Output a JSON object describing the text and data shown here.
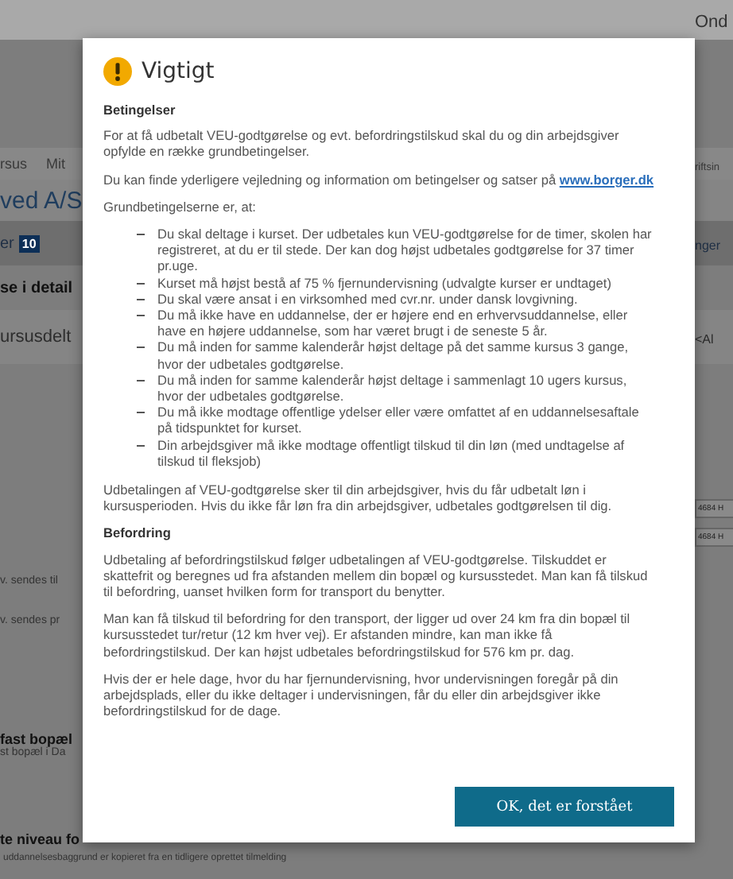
{
  "background": {
    "rows": [
      {
        "kind": "top",
        "right": "Ond"
      },
      {
        "kind": "nav",
        "left": [
          "rsus",
          "Mit"
        ],
        "right": "riftsin"
      },
      {
        "kind": "title",
        "left": [
          "ved A/S"
        ]
      },
      {
        "kind": "tabs",
        "left": [
          "er"
        ],
        "badge": "10",
        "right": "nger"
      },
      {
        "kind": "section",
        "left": [
          "se i detail"
        ]
      },
      {
        "kind": "subtitle",
        "left": [
          "ursusdelt"
        ],
        "right": "<Al"
      },
      {
        "kind": "input",
        "right": "4684 H"
      },
      {
        "kind": "input",
        "right": "4684 H"
      },
      {
        "kind": "field",
        "left": [
          "v. sendes til"
        ]
      },
      {
        "kind": "field",
        "left": [
          "v. sendes pr"
        ]
      },
      {
        "kind": "bold",
        "left": [
          "fast bopæl"
        ],
        "sub": "st bopæl i Da"
      },
      {
        "kind": "bold",
        "left": [
          "te niveau fo"
        ]
      }
    ],
    "footer_note": "uddannelsesbaggrund er kopieret fra en tidligere oprettet tilmelding"
  },
  "dialog": {
    "title": "Vigtigt",
    "sections": [
      {
        "kind": "heading",
        "text": "Betingelser"
      },
      {
        "kind": "paragraph",
        "text": "For at få udbetalt VEU-godtgørelse og evt. befordringstilskud skal du og din arbejdsgiver opfylde en række grundbetingelser."
      },
      {
        "kind": "link_paragraph",
        "text": "Du kan finde yderligere vejledning og information om betingelser og satser på",
        "link": "www.borger.dk"
      },
      {
        "kind": "paragraph",
        "text": "Grundbetingelserne er, at:"
      },
      {
        "kind": "list",
        "items": [
          "Du skal deltage i kurset. Der udbetales kun VEU-godtgørelse for de timer, skolen har registreret, at du er til stede. Der kan dog højst udbetales godtgørelse for 37 timer pr.uge.",
          "Kurset må højst bestå af 75 % fjernundervisning (udvalgte kurser er undtaget)",
          "Du skal være ansat i en virksomhed med cvr.nr. under dansk lovgivning.",
          "Du må ikke have en uddannelse, der er højere end en erhvervsuddannelse, eller have en højere uddannelse, som har været brugt i de seneste 5 år.",
          "Du må inden for samme kalenderår højst deltage på det samme kursus 3 gange, hvor der udbetales godtgørelse.",
          "Du må inden for samme kalenderår højst deltage i sammenlagt 10 ugers kursus, hvor der udbetales godtgørelse.",
          "Du må ikke modtage offentlige ydelser eller være omfattet af en uddannelsesaftale på tidspunktet for kurset.",
          "Din arbejdsgiver må ikke modtage offentligt tilskud til din løn (med undtagelse af tilskud til fleksjob)"
        ]
      },
      {
        "kind": "paragraph",
        "text": "Udbetalingen af VEU-godtgørelse sker til din arbejdsgiver, hvis du får udbetalt løn i kursusperioden. Hvis du ikke får løn fra din arbejdsgiver, udbetales godtgørelsen til dig."
      },
      {
        "kind": "heading",
        "text": "Befordring"
      },
      {
        "kind": "paragraph",
        "text": "Udbetaling af befordringstilskud følger udbetalingen af VEU-godtgørelse. Tilskuddet er skattefrit og beregnes ud fra afstanden mellem din bopæl og kursusstedet. Man kan få tilskud til befordring, uanset hvilken form for transport du benytter."
      },
      {
        "kind": "paragraph",
        "text": "Man kan få tilskud til befordring for den transport, der ligger ud over 24 km fra din bopæl til kursusstedet tur/retur (12 km hver vej). Er afstanden mindre, kan man ikke få befordringstilskud. Der kan højst udbetales befordringstilskud for 576 km pr. dag."
      },
      {
        "kind": "paragraph",
        "text": "Hvis der er hele dage, hvor du har fjernundervisning, hvor undervisningen foregår på din arbejdsplads, eller du ikke deltager i undervisningen, får du eller din arbejdsgiver ikke befordringstilskud for de dage."
      }
    ],
    "button": "OK, det er forstået"
  }
}
